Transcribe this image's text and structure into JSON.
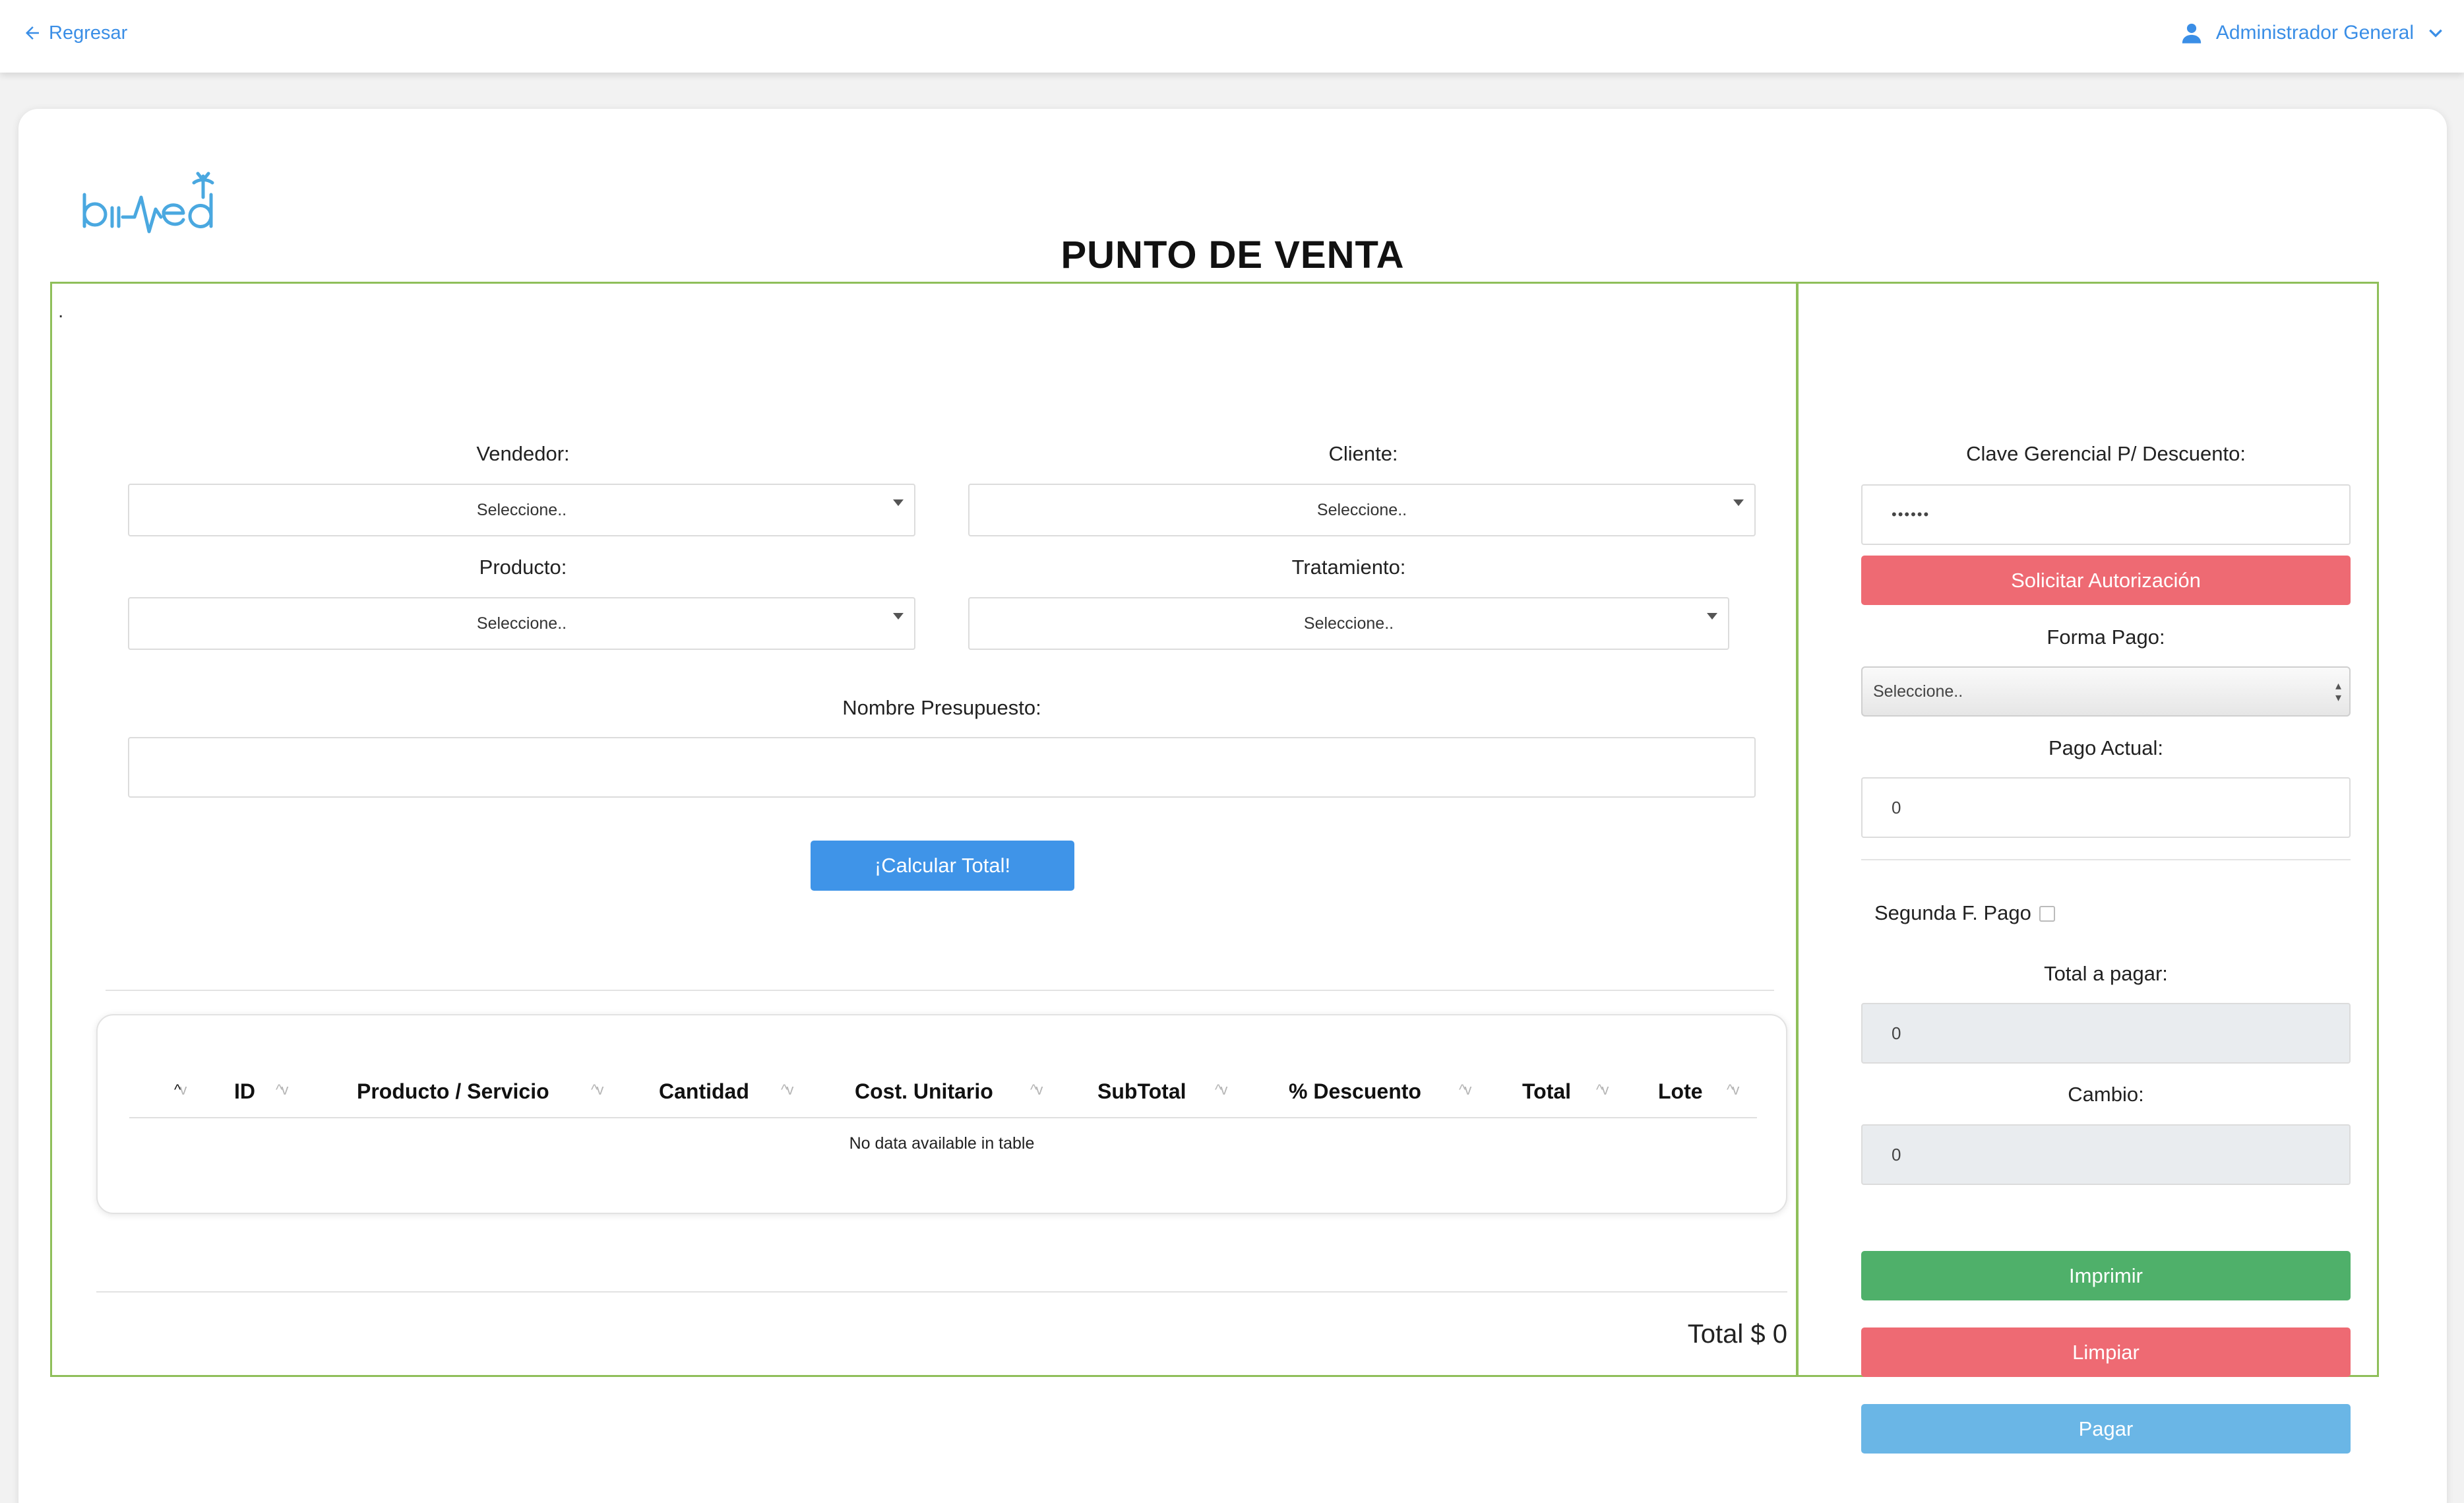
{
  "nav": {
    "back_label": "Regresar",
    "user_label": "Administrador General"
  },
  "header": {
    "title": "PUNTO DE VENTA",
    "dot": "."
  },
  "form": {
    "vendedor_label": "Vendedor:",
    "vendedor_value": "Seleccione..",
    "cliente_label": "Cliente:",
    "cliente_value": "Seleccione..",
    "producto_label": "Producto:",
    "producto_value": "Seleccione..",
    "tratamiento_label": "Tratamiento:",
    "tratamiento_value": "Seleccione..",
    "presupuesto_label": "Nombre Presupuesto:",
    "presupuesto_value": "",
    "calcular_label": "¡Calcular Total!"
  },
  "table": {
    "columns": [
      "ID",
      "Producto / Servicio",
      "Cantidad",
      "Cost. Unitario",
      "SubTotal",
      "% Descuento",
      "Total",
      "Lote"
    ],
    "empty_message": "No data available in table"
  },
  "summary": {
    "total_text": "Total $ 0"
  },
  "payment": {
    "clave_label": "Clave Gerencial P/ Descuento:",
    "clave_value": "••••••",
    "autorizar_label": "Solicitar Autorización",
    "forma_label": "Forma Pago:",
    "forma_value": "Seleccione..",
    "pago_actual_label": "Pago Actual:",
    "pago_actual_value": "0",
    "segunda_label": "Segunda F. Pago",
    "total_pagar_label": "Total a pagar:",
    "total_pagar_value": "0",
    "cambio_label": "Cambio:",
    "cambio_value": "0",
    "imprimir_label": "Imprimir",
    "limpiar_label": "Limpiar",
    "pagar_label": "Pagar"
  },
  "colors": {
    "accent": "#3a8ee6",
    "panel_border": "#8fbf5a",
    "danger": "#ee6a73",
    "success": "#4fb06a",
    "info": "#6ab6e6"
  }
}
